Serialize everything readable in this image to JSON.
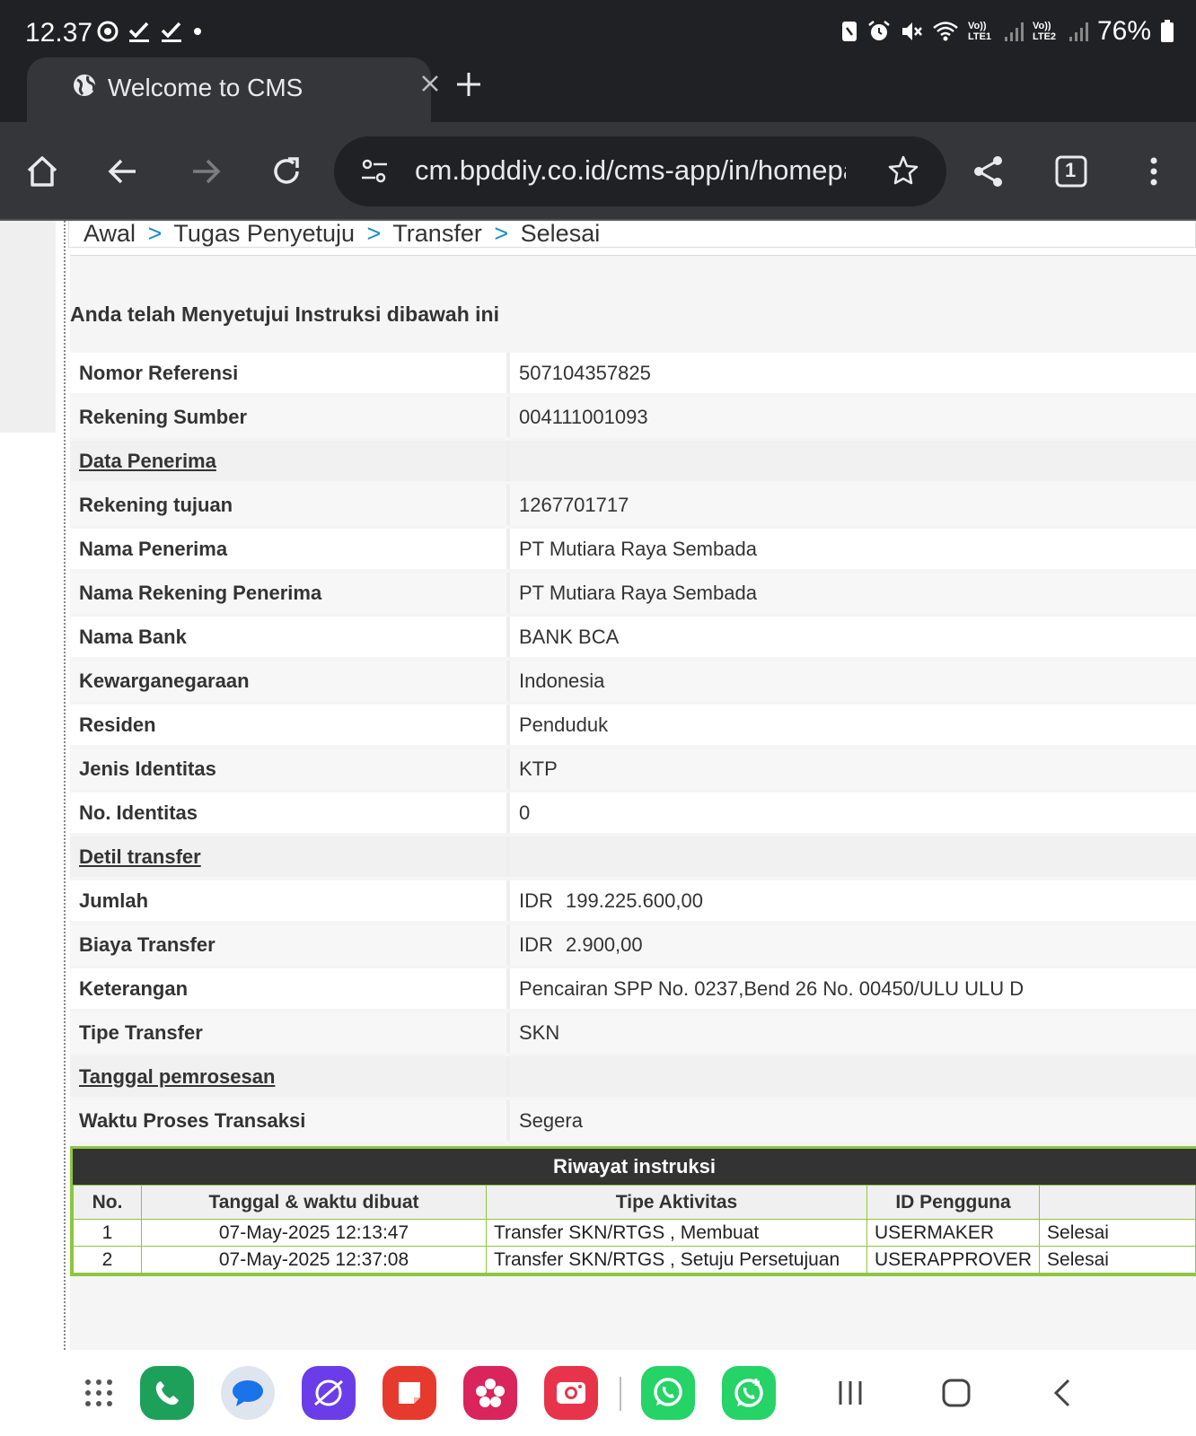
{
  "status_bar": {
    "time": "12.37",
    "battery": "76%",
    "sim1": "Vo)) LTE1",
    "sim2": "Vo)) LTE2"
  },
  "browser": {
    "tab_title": "Welcome to CMS",
    "url": "cm.bpddiy.co.id/cms-app/in/homepage",
    "tab_count": "1"
  },
  "breadcrumb": {
    "items": [
      "Awal",
      "Tugas Penyetuju",
      "Transfer",
      "Selesai"
    ],
    "separator": ">"
  },
  "page": {
    "title": "Anda telah Menyetujui Instruksi dibawah ini"
  },
  "details": [
    {
      "label": "Nomor Referensi",
      "value": "507104357825"
    },
    {
      "label": "Rekening Sumber",
      "value": "004111001093"
    },
    {
      "label": "Data Penerima",
      "value": "",
      "section": true
    },
    {
      "label": "Rekening tujuan",
      "value": "1267701717"
    },
    {
      "label": "Nama Penerima",
      "value": "PT Mutiara Raya Sembada"
    },
    {
      "label": "Nama Rekening Penerima",
      "value": "PT Mutiara Raya Sembada"
    },
    {
      "label": "Nama Bank",
      "value": "BANK BCA"
    },
    {
      "label": "Kewarganegaraan",
      "value": "Indonesia"
    },
    {
      "label": "Residen",
      "value": "Penduduk"
    },
    {
      "label": "Jenis Identitas",
      "value": "KTP"
    },
    {
      "label": "No. Identitas",
      "value": "0"
    },
    {
      "label": "Detil transfer",
      "value": "",
      "section": true
    },
    {
      "label": "Jumlah",
      "currency": "IDR",
      "value": "199.225.600,00"
    },
    {
      "label": "Biaya Transfer",
      "currency": "IDR",
      "value": "2.900,00"
    },
    {
      "label": "Keterangan",
      "value": "Pencairan SPP No. 0237,Bend 26 No. 00450/ULU ULU D"
    },
    {
      "label": "Tipe Transfer",
      "value": "SKN"
    },
    {
      "label": "Tanggal pemrosesan",
      "value": "",
      "section": true
    },
    {
      "label": "Waktu Proses Transaksi",
      "value": "Segera"
    }
  ],
  "history": {
    "title": "Riwayat instruksi",
    "columns": [
      "No.",
      "Tanggal & waktu dibuat",
      "Tipe Aktivitas",
      "ID Pengguna",
      ""
    ],
    "rows": [
      {
        "no": "1",
        "date": "07-May-2025 12:13:47",
        "activity": "Transfer SKN/RTGS   ,  Membuat",
        "user": "USERMAKER",
        "status": "Selesai"
      },
      {
        "no": "2",
        "date": "07-May-2025 12:37:08",
        "activity": "Transfer SKN/RTGS   ,  Setuju Persetujuan",
        "user": "USERAPPROVER",
        "status": "Selesai"
      }
    ]
  },
  "colors": {
    "browser_dark": "#202124",
    "toolbar": "#35363a",
    "breadcrumb_separator": "#1a8fbf",
    "history_border": "#8dc63f",
    "history_header": "#333333"
  },
  "dock_apps": [
    "apps-grid-icon",
    "phone-icon",
    "messages-icon",
    "internet-icon",
    "notes-icon",
    "gallery-icon",
    "camera-icon",
    "whatsapp-icon",
    "whatsapp-business-icon"
  ]
}
